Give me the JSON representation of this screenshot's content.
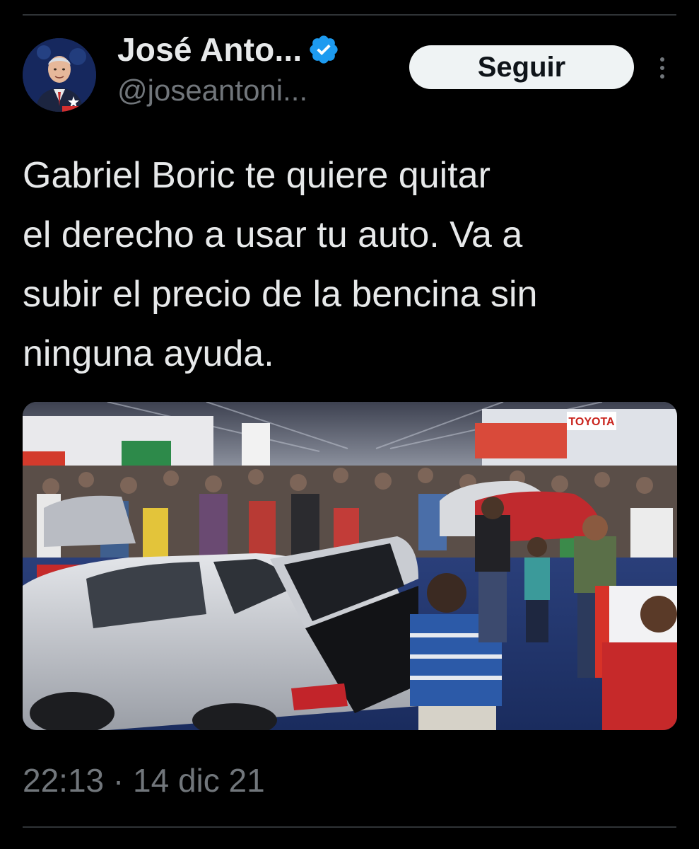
{
  "tweet": {
    "author": {
      "display_name": "José Anto...",
      "handle": "@joseantoni...",
      "verified": true,
      "verified_icon": "verified-badge-icon",
      "avatar_icon": "avatar"
    },
    "follow_label": "Seguir",
    "more_icon": "more-vertical-icon",
    "text": "Gabriel Boric te quiere quitar\nel derecho a usar tu auto. Va a\nsubir el precio de la bencina sin\nninguna ayuda.",
    "media": {
      "type": "photo",
      "sign_text": "TOYOTA"
    },
    "timestamp": "22:13 · 14 dic 21"
  },
  "colors": {
    "background": "#000000",
    "text_primary": "#e7e9ea",
    "text_secondary": "#71767b",
    "verified_blue": "#1d9bf0",
    "button_bg": "#eff3f4",
    "button_text": "#0f1419",
    "divider": "#2f3336"
  }
}
